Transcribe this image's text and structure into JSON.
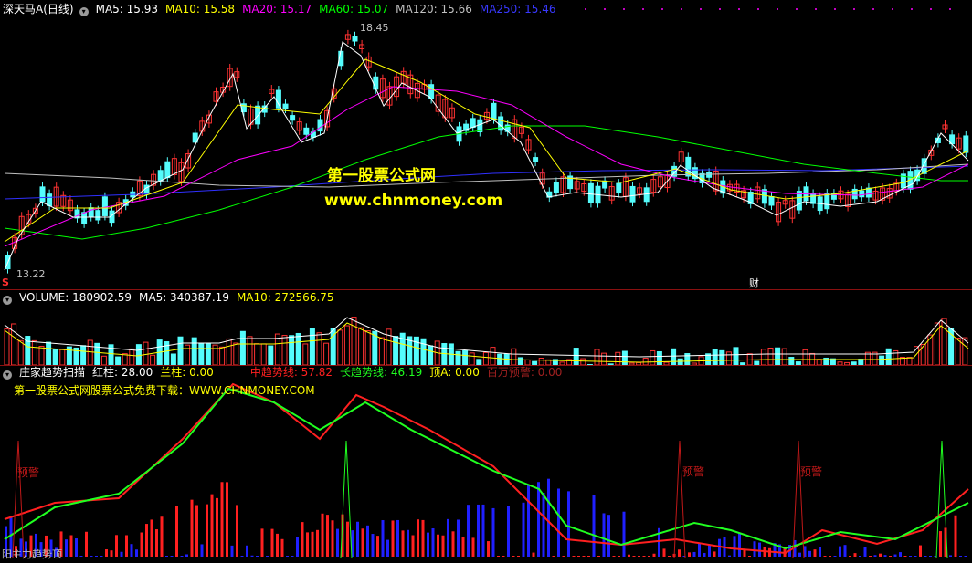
{
  "price_header": {
    "title": "深天马A",
    "period": "(日线)",
    "ma5": "MA5: 15.93",
    "ma10": "MA10: 15.58",
    "ma20": "MA20: 15.17",
    "ma60": "MA60: 15.07",
    "ma120": "MA120: 15.66",
    "ma250": "MA250: 15.46"
  },
  "price_labels": {
    "high": "18.45",
    "low": "13.22",
    "fin_marker": "财",
    "s_marker": "S"
  },
  "watermark": {
    "line1": "第一股票公式网",
    "line2": "www.chnmoney.com"
  },
  "volume_header": {
    "volume": "VOLUME: 180902.59",
    "ma5": "MA5: 340387.19",
    "ma10": "MA10: 272566.75"
  },
  "indicator_header": {
    "name": "庄家趋势扫描",
    "red": "红柱: 28.00",
    "blue": "兰柱: 0.00",
    "mid": "中趋势线: 57.82",
    "long": "长趋势线: 46.19",
    "top": "顶A: 0.00",
    "million": "百万预警: 0.00"
  },
  "indicator_subtitle": "第一股票公式网股票公式免费下载：WWW.CHNMONEY.COM",
  "warning_labels": [
    "预警",
    "预警",
    "预警"
  ],
  "bottom_left_label": "阳主力趋势顶",
  "colors": {
    "background": "#000000",
    "up_candle": "#ff3232",
    "down_candle": "#54fcfc",
    "ma5": "#ffffff",
    "ma10": "#ffff00",
    "ma20": "#ff00ff",
    "ma60": "#00ff00",
    "ma120": "#c0c0c0",
    "ma250": "#3030ff",
    "mid_line": "#ff2020",
    "long_line": "#20ff20",
    "blue_bar": "#2020ff",
    "red_bar": "#ff2020"
  }
}
